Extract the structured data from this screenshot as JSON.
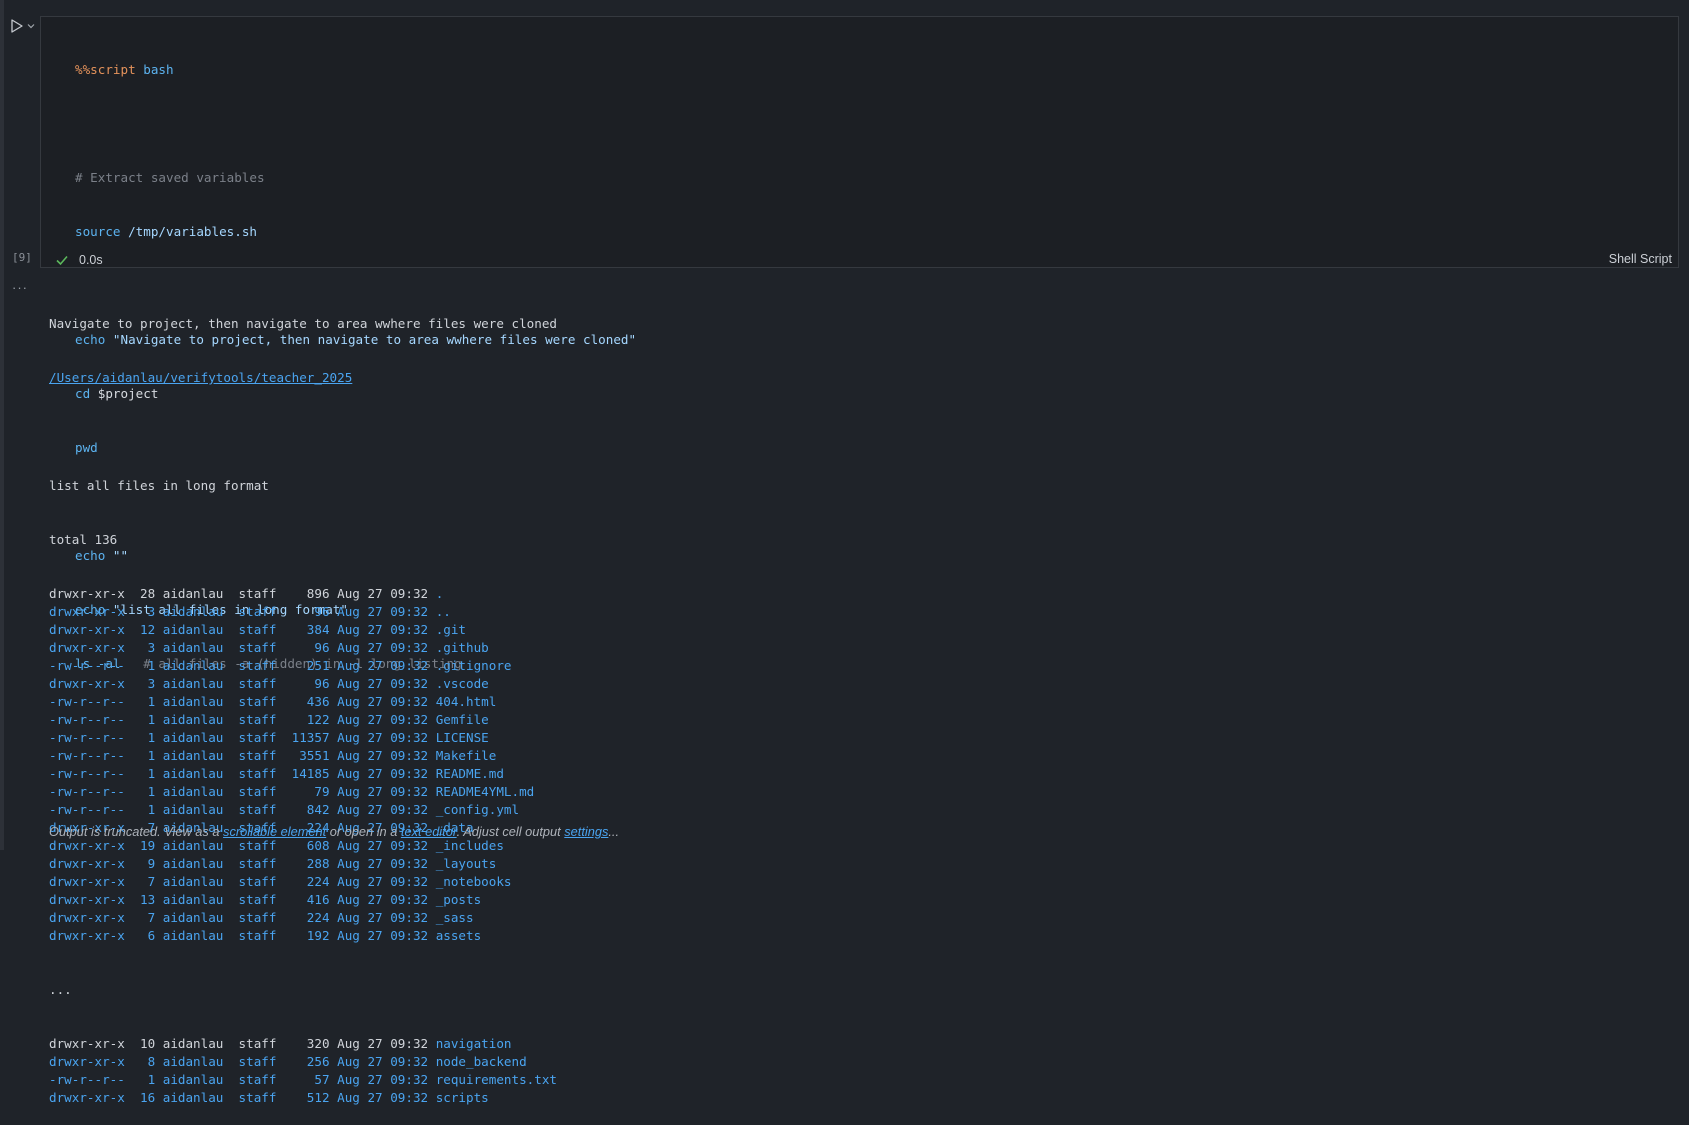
{
  "cell": {
    "exec_count": "[9]",
    "duration": "0.0s",
    "language": "Shell Script",
    "code": {
      "l1_magic": "%%script",
      "l1_arg": " bash",
      "l3": "# Extract saved variables",
      "l4_kw": "source",
      "l4_rest": " /tmp/variables.sh",
      "l6_kw": "echo",
      "l6_str": " \"Navigate to project, then navigate to area wwhere files were cloned\"",
      "l7_kw": "cd",
      "l7_rest": " $project",
      "l8_kw": "pwd",
      "l10_kw": "echo",
      "l10_str": " \"\"",
      "l11_kw": "echo",
      "l11_str": " \"list all files in long format\"",
      "l12_kw": "ls",
      "l12_flag": " -al",
      "l12_cmt": "   # all files -a (hidden) in -l long listing"
    }
  },
  "output": {
    "more_label": "···",
    "line1": "Navigate to project, then navigate to area wwhere files were cloned",
    "path": "/Users/aidanlau/verifytools/teacher_2025",
    "heading": "list all files in long format",
    "total": "total 136",
    "ellipsis": "...",
    "rows_top": [
      {
        "meta": "drwxr-xr-x  28 aidanlau  staff    896 Aug 27 09:32 ",
        "name": ".",
        "meta_color": "white"
      },
      {
        "meta": "drwxr-xr-x   3 aidanlau  staff     96 Aug 27 09:32 ",
        "name": "..",
        "meta_color": "blue"
      },
      {
        "meta": "drwxr-xr-x  12 aidanlau  staff    384 Aug 27 09:32 ",
        "name": ".git",
        "meta_color": "blue"
      },
      {
        "meta": "drwxr-xr-x   3 aidanlau  staff     96 Aug 27 09:32 ",
        "name": ".github",
        "meta_color": "blue"
      },
      {
        "meta": "-rw-r--r--   1 aidanlau  staff    251 Aug 27 09:32 ",
        "name": ".gitignore",
        "meta_color": "blue"
      },
      {
        "meta": "drwxr-xr-x   3 aidanlau  staff     96 Aug 27 09:32 ",
        "name": ".vscode",
        "meta_color": "blue"
      },
      {
        "meta": "-rw-r--r--   1 aidanlau  staff    436 Aug 27 09:32 ",
        "name": "404.html",
        "meta_color": "blue"
      },
      {
        "meta": "-rw-r--r--   1 aidanlau  staff    122 Aug 27 09:32 ",
        "name": "Gemfile",
        "meta_color": "blue"
      },
      {
        "meta": "-rw-r--r--   1 aidanlau  staff  11357 Aug 27 09:32 ",
        "name": "LICENSE",
        "meta_color": "blue"
      },
      {
        "meta": "-rw-r--r--   1 aidanlau  staff   3551 Aug 27 09:32 ",
        "name": "Makefile",
        "meta_color": "blue"
      },
      {
        "meta": "-rw-r--r--   1 aidanlau  staff  14185 Aug 27 09:32 ",
        "name": "README.md",
        "meta_color": "blue"
      },
      {
        "meta": "-rw-r--r--   1 aidanlau  staff     79 Aug 27 09:32 ",
        "name": "README4YML.md",
        "meta_color": "blue"
      },
      {
        "meta": "-rw-r--r--   1 aidanlau  staff    842 Aug 27 09:32 ",
        "name": "_config.yml",
        "meta_color": "blue"
      },
      {
        "meta": "drwxr-xr-x   7 aidanlau  staff    224 Aug 27 09:32 ",
        "name": "_data",
        "meta_color": "blue"
      },
      {
        "meta": "drwxr-xr-x  19 aidanlau  staff    608 Aug 27 09:32 ",
        "name": "_includes",
        "meta_color": "blue"
      },
      {
        "meta": "drwxr-xr-x   9 aidanlau  staff    288 Aug 27 09:32 ",
        "name": "_layouts",
        "meta_color": "blue"
      },
      {
        "meta": "drwxr-xr-x   7 aidanlau  staff    224 Aug 27 09:32 ",
        "name": "_notebooks",
        "meta_color": "blue"
      },
      {
        "meta": "drwxr-xr-x  13 aidanlau  staff    416 Aug 27 09:32 ",
        "name": "_posts",
        "meta_color": "blue"
      },
      {
        "meta": "drwxr-xr-x   7 aidanlau  staff    224 Aug 27 09:32 ",
        "name": "_sass",
        "meta_color": "blue"
      },
      {
        "meta": "drwxr-xr-x   6 aidanlau  staff    192 Aug 27 09:32 ",
        "name": "assets",
        "meta_color": "blue"
      }
    ],
    "rows_bottom": [
      {
        "meta": "drwxr-xr-x  10 aidanlau  staff    320 Aug 27 09:32 ",
        "name": "navigation",
        "meta_color": "white"
      },
      {
        "meta": "drwxr-xr-x   8 aidanlau  staff    256 Aug 27 09:32 ",
        "name": "node_backend",
        "meta_color": "blue"
      },
      {
        "meta": "-rw-r--r--   1 aidanlau  staff     57 Aug 27 09:32 ",
        "name": "requirements.txt",
        "meta_color": "blue"
      },
      {
        "meta": "drwxr-xr-x  16 aidanlau  staff    512 Aug 27 09:32 ",
        "name": "scripts",
        "meta_color": "blue"
      }
    ],
    "truncated": {
      "t1": "Output is truncated. View as a ",
      "link1": "scrollable element",
      "t2": " or open in a ",
      "link2": "text editor",
      "t3": ". Adjust cell output ",
      "link3": "settings",
      "t4": "..."
    }
  },
  "colors": {
    "accent": "#4aa4f0",
    "success": "#5cb85c",
    "magic": "#e4925b"
  }
}
